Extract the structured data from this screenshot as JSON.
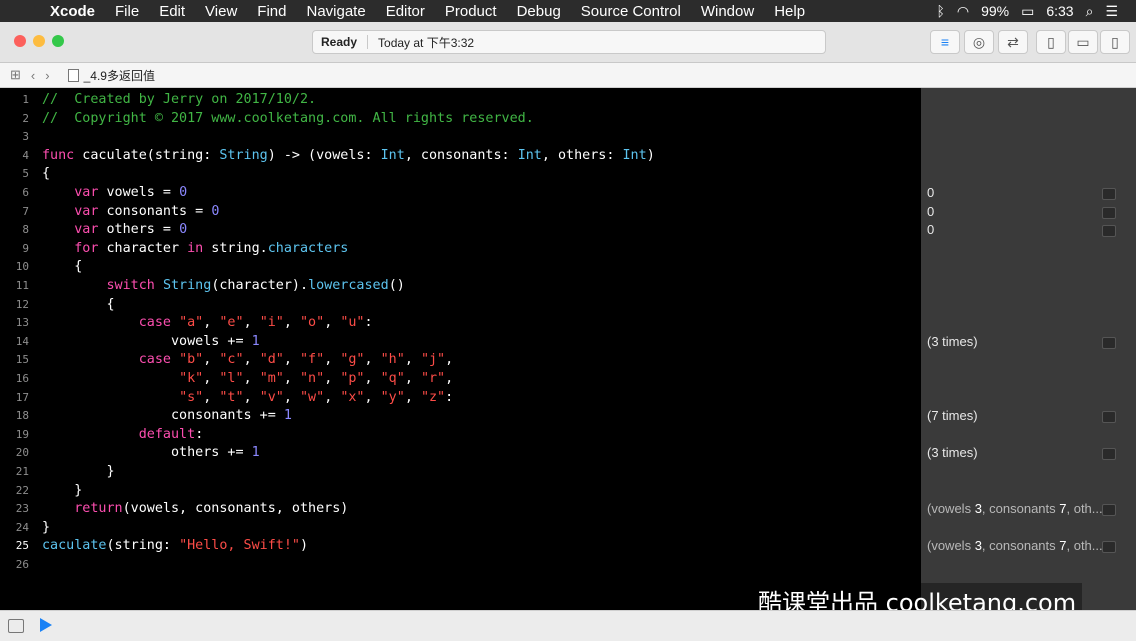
{
  "menubar": {
    "apple": "",
    "items": [
      "Xcode",
      "File",
      "Edit",
      "View",
      "Find",
      "Navigate",
      "Editor",
      "Product",
      "Debug",
      "Source Control",
      "Window",
      "Help"
    ],
    "battery": "99%",
    "time": "6:33"
  },
  "toolbar": {
    "status": "Ready",
    "timestamp": "Today at 下午3:32"
  },
  "jumpbar": {
    "filename": "_4.9多返回值"
  },
  "editor": {
    "lines": [
      {
        "n": "1",
        "html": "<span class='cmt'>//  Created by Jerry on 2017/10/2.</span>"
      },
      {
        "n": "2",
        "html": "<span class='cmt'>//  Copyright © 2017 www.coolketang.com. All rights reserved.</span>"
      },
      {
        "n": "3",
        "html": ""
      },
      {
        "n": "4",
        "html": "<span class='kw'>func</span> caculate(string: <span class='ty'>String</span>) -> (vowels: <span class='ty'>Int</span>, consonants: <span class='ty'>Int</span>, others: <span class='ty'>Int</span>)"
      },
      {
        "n": "5",
        "html": "{"
      },
      {
        "n": "6",
        "html": "    <span class='kw'>var</span> vowels = <span class='num'>0</span>"
      },
      {
        "n": "7",
        "html": "    <span class='kw'>var</span> consonants = <span class='num'>0</span>"
      },
      {
        "n": "8",
        "html": "    <span class='kw'>var</span> others = <span class='num'>0</span>"
      },
      {
        "n": "9",
        "html": "    <span class='kw'>for</span> character <span class='kw'>in</span> string.<span class='fn'>characters</span>"
      },
      {
        "n": "10",
        "html": "    {"
      },
      {
        "n": "11",
        "html": "        <span class='kw'>switch</span> <span class='ty'>String</span>(character).<span class='fn'>lowercased</span>()"
      },
      {
        "n": "12",
        "html": "        {"
      },
      {
        "n": "13",
        "html": "            <span class='kw'>case</span> <span class='str'>\"a\"</span>, <span class='str'>\"e\"</span>, <span class='str'>\"i\"</span>, <span class='str'>\"o\"</span>, <span class='str'>\"u\"</span>:"
      },
      {
        "n": "14",
        "html": "                vowels += <span class='num'>1</span>"
      },
      {
        "n": "15",
        "html": "            <span class='kw'>case</span> <span class='str'>\"b\"</span>, <span class='str'>\"c\"</span>, <span class='str'>\"d\"</span>, <span class='str'>\"f\"</span>, <span class='str'>\"g\"</span>, <span class='str'>\"h\"</span>, <span class='str'>\"j\"</span>,"
      },
      {
        "n": "16",
        "html": "                 <span class='str'>\"k\"</span>, <span class='str'>\"l\"</span>, <span class='str'>\"m\"</span>, <span class='str'>\"n\"</span>, <span class='str'>\"p\"</span>, <span class='str'>\"q\"</span>, <span class='str'>\"r\"</span>,"
      },
      {
        "n": "17",
        "html": "                 <span class='str'>\"s\"</span>, <span class='str'>\"t\"</span>, <span class='str'>\"v\"</span>, <span class='str'>\"w\"</span>, <span class='str'>\"x\"</span>, <span class='str'>\"y\"</span>, <span class='str'>\"z\"</span>:"
      },
      {
        "n": "18",
        "html": "                consonants += <span class='num'>1</span>"
      },
      {
        "n": "19",
        "html": "            <span class='kw'>default</span>:"
      },
      {
        "n": "20",
        "html": "                others += <span class='num'>1</span>"
      },
      {
        "n": "21",
        "html": "        }"
      },
      {
        "n": "22",
        "html": "    }"
      },
      {
        "n": "23",
        "html": "    <span class='kw'>return</span>(vowels, consonants, others)"
      },
      {
        "n": "24",
        "html": "}"
      },
      {
        "n": "25",
        "html": "<span class='fn'>caculate</span>(string: <span class='str'>\"Hello, Swift!\"</span>)"
      },
      {
        "n": "26",
        "html": ""
      }
    ]
  },
  "results": [
    {
      "line": 6,
      "html": "0"
    },
    {
      "line": 7,
      "html": "0"
    },
    {
      "line": 8,
      "html": "0"
    },
    {
      "line": 14,
      "html": "(3 times)"
    },
    {
      "line": 18,
      "html": "(7 times)"
    },
    {
      "line": 20,
      "html": "(3 times)"
    },
    {
      "line": 23,
      "html": "<span class='dim'>(vowels </span><span class='hl'>3</span><span class='dim'>, consonants </span><span class='hl'>7</span><span class='dim'>, oth...</span>"
    },
    {
      "line": 25,
      "html": "<span class='dim'>(vowels </span><span class='hl'>3</span><span class='dim'>, consonants </span><span class='hl'>7</span><span class='dim'>, oth...</span>"
    }
  ],
  "watermark": "酷课堂出品 coolketang.com"
}
